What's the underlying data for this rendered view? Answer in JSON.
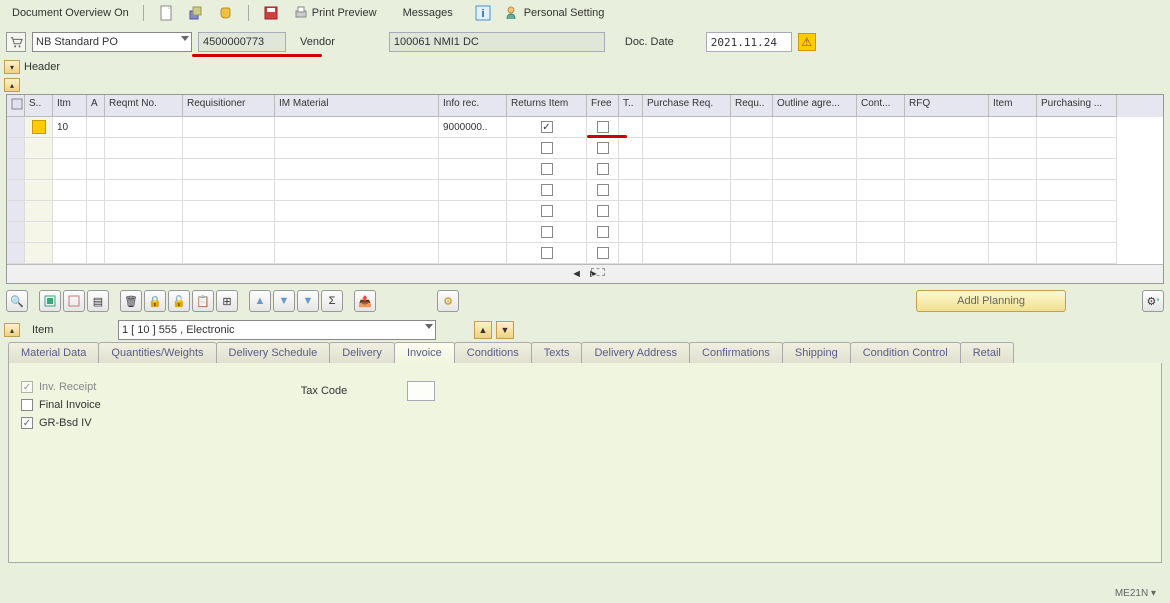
{
  "toolbar": {
    "doc_overview": "Document Overview On",
    "print_preview": "Print Preview",
    "messages": "Messages",
    "personal_setting": "Personal Setting"
  },
  "header": {
    "po_type": "NB Standard PO",
    "po_number": "4500000773",
    "vendor_label": "Vendor",
    "vendor_value": "100061 NMI1 DC",
    "doc_date_label": "Doc. Date",
    "doc_date_value": "2021.11.24",
    "header_label": "Header"
  },
  "grid": {
    "columns": [
      "S..",
      "Itm",
      "A",
      "Reqmt No.",
      "Requisitioner",
      "IM Material",
      "Info rec.",
      "Returns Item",
      "Free",
      "T..",
      "Purchase Req.",
      "Requ..",
      "Outline agre...",
      "Cont...",
      "RFQ",
      "Item",
      "Purchasing ..."
    ],
    "widths": [
      28,
      34,
      18,
      78,
      92,
      164,
      68,
      80,
      32,
      24,
      88,
      42,
      84,
      48,
      84,
      48,
      80
    ],
    "rows": [
      {
        "status": "warn",
        "itm": "10",
        "info_rec": "9000000..",
        "returns": true,
        "free": false
      },
      {
        "status": "",
        "itm": "",
        "info_rec": "",
        "returns": false,
        "free": false
      },
      {
        "status": "",
        "itm": "",
        "info_rec": "",
        "returns": false,
        "free": false
      },
      {
        "status": "",
        "itm": "",
        "info_rec": "",
        "returns": false,
        "free": false
      },
      {
        "status": "",
        "itm": "",
        "info_rec": "",
        "returns": false,
        "free": false
      },
      {
        "status": "",
        "itm": "",
        "info_rec": "",
        "returns": false,
        "free": false
      },
      {
        "status": "",
        "itm": "",
        "info_rec": "",
        "returns": false,
        "free": false
      }
    ]
  },
  "action": {
    "addl_planning": "Addl Planning"
  },
  "item_select": {
    "label": "Item",
    "value": "1 [ 10 ] 555 , Electronic"
  },
  "tabs": [
    "Material Data",
    "Quantities/Weights",
    "Delivery Schedule",
    "Delivery",
    "Invoice",
    "Conditions",
    "Texts",
    "Delivery Address",
    "Confirmations",
    "Shipping",
    "Condition Control",
    "Retail"
  ],
  "active_tab": 4,
  "invoice_tab": {
    "inv_receipt": "Inv. Receipt",
    "final_invoice": "Final Invoice",
    "gr_bsd_iv": "GR-Bsd IV",
    "tax_code": "Tax Code"
  },
  "footer": {
    "tcode": "ME21N"
  }
}
